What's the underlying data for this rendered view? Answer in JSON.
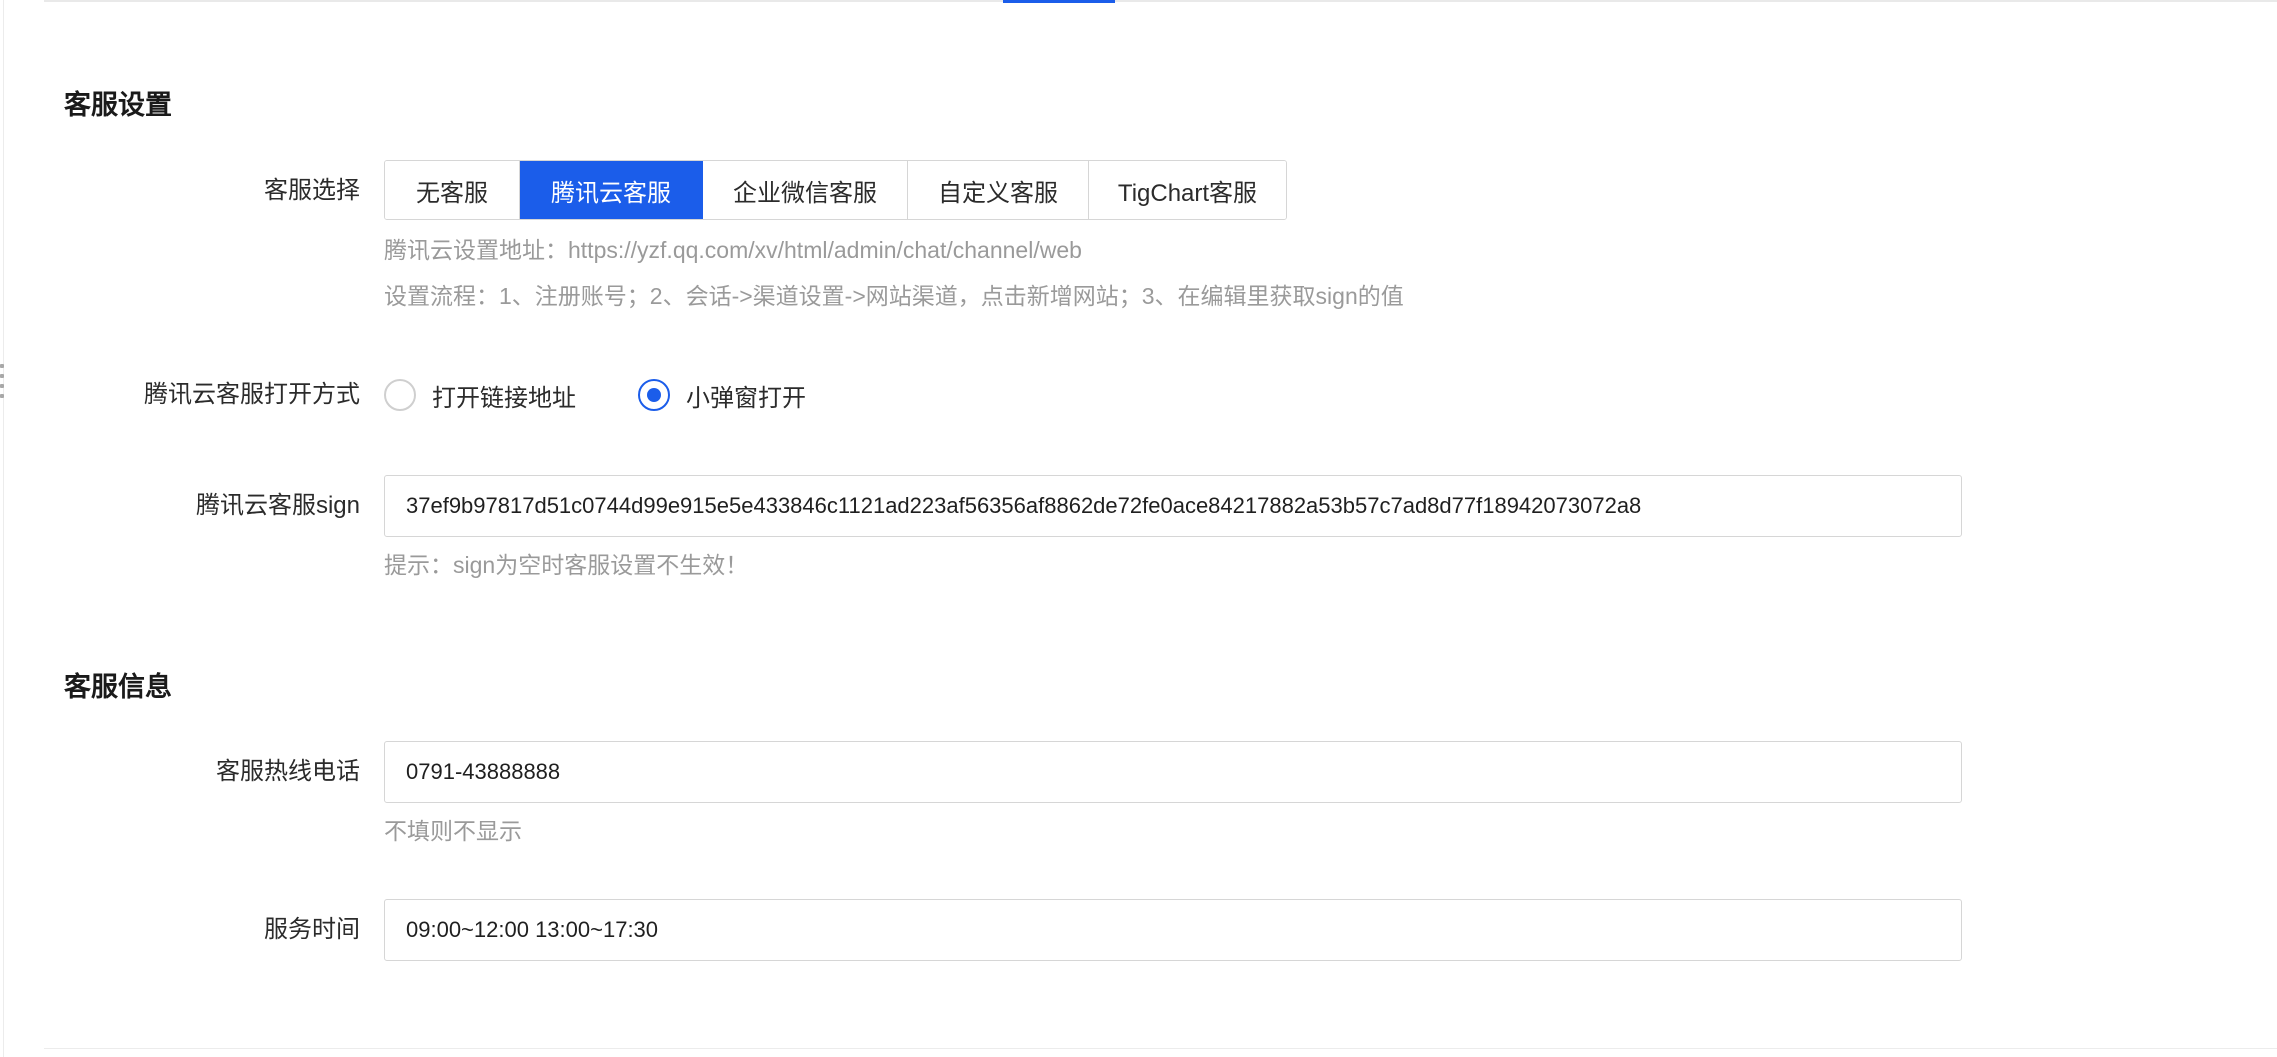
{
  "settings_section": {
    "title": "客服设置",
    "service_select": {
      "label": "客服选择",
      "options": [
        "无客服",
        "腾讯云客服",
        "企业微信客服",
        "自定义客服",
        "TigChart客服"
      ],
      "selected": "腾讯云客服"
    },
    "help_address": "腾讯云设置地址：https://yzf.qq.com/xv/html/admin/chat/channel/web",
    "help_flow": "设置流程：1、注册账号；2、会话->渠道设置->网站渠道，点击新增网站；3、在编辑里获取sign的值",
    "open_mode": {
      "label": "腾讯云客服打开方式",
      "options": [
        "打开链接地址",
        "小弹窗打开"
      ],
      "selected": "小弹窗打开"
    },
    "sign": {
      "label": "腾讯云客服sign",
      "value": "37ef9b97817d51c0744d99e915e5e433846c1121ad223af56356af8862de72fe0ace84217882a53b57c7ad8d77f18942073072a8",
      "hint": "提示：sign为空时客服设置不生效！"
    }
  },
  "info_section": {
    "title": "客服信息",
    "hotline": {
      "label": "客服热线电话",
      "value": "0791-43888888",
      "hint": "不填则不显示"
    },
    "service_time": {
      "label": "服务时间",
      "value": "09:00~12:00 13:00~17:30"
    }
  },
  "colors": {
    "accent": "#1b5dea",
    "border": "#d6d6d6",
    "help_text": "#9a9a9a"
  }
}
